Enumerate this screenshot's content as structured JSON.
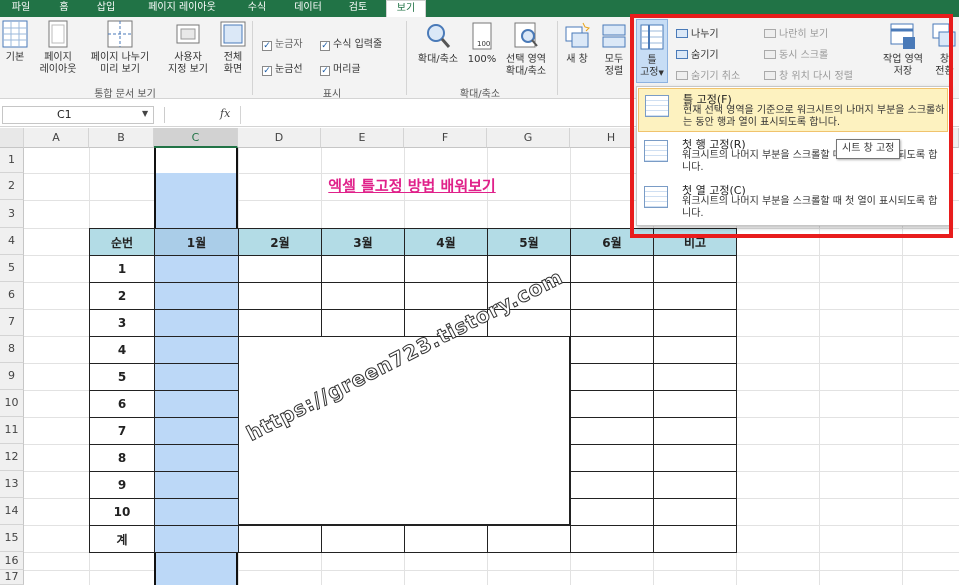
{
  "tabs": [
    "파일",
    "홈",
    "삽입",
    "페이지 레이아웃",
    "수식",
    "데이터",
    "검토",
    "보기"
  ],
  "active_tab": "보기",
  "ribbon": {
    "workbook_views": {
      "normal": "기본",
      "page_layout": [
        "페이지",
        "레이아웃"
      ],
      "page_break": [
        "페이지 나누기",
        "미리 보기"
      ],
      "custom": [
        "사용자",
        "지정 보기"
      ],
      "full": [
        "전체",
        "화면"
      ],
      "group_label": "통합 문서 보기"
    },
    "show": {
      "ruler": "눈금자",
      "formula_bar": "수식 입력줄",
      "gridlines": "눈금선",
      "headings": "머리글",
      "group_label": "표시"
    },
    "zoom": {
      "zoom": "확대/축소",
      "hundred": "100%",
      "zoom_selection": [
        "선택 영역",
        "확대/축소"
      ],
      "group_label": "확대/축소"
    },
    "window": {
      "new_window": "새 창",
      "arrange_all": [
        "모두",
        "정렬"
      ],
      "freeze": [
        "틀",
        "고정"
      ],
      "split": "나누기",
      "hide": "숨기기",
      "unhide": "숨기기 취소",
      "side_by_side": "나란히 보기",
      "sync_scroll": "동시 스크롤",
      "reset_position": "창 위치 다시 정렬",
      "save_workspace": [
        "작업 영역",
        "저장"
      ],
      "switch": [
        "창",
        "전환"
      ]
    }
  },
  "name_box": "C1",
  "fx": "fx",
  "columns": [
    "A",
    "B",
    "C",
    "D",
    "E",
    "F",
    "G",
    "H",
    "I"
  ],
  "rows": [
    "1",
    "2",
    "3",
    "4",
    "5",
    "6",
    "7",
    "8",
    "9",
    "10",
    "11",
    "12",
    "13",
    "14",
    "15",
    "16",
    "17"
  ],
  "sheet": {
    "title": "엑셀 틀고정 방법 배워보기",
    "headers": [
      "순번",
      "1월",
      "2월",
      "3월",
      "4월",
      "5월",
      "6월",
      "비고"
    ],
    "row_labels": [
      "1",
      "2",
      "3",
      "4",
      "5",
      "6",
      "7",
      "8",
      "9",
      "10",
      "계"
    ],
    "watermark": "https://green723.tistory.com"
  },
  "freeze_menu": {
    "items": [
      {
        "title": "틀 고정(F)",
        "desc": "현재 선택 영역을 기준으로 워크시트의 나머지 부분을 스크롤하는 동안 행과 열이 표시되도록 합니다."
      },
      {
        "title": "첫 행 고정(R)",
        "desc": "워크시트의 나머지 부분을 스크롤할 때 첫 행이 표시되도록 합니다."
      },
      {
        "title": "첫 열 고정(C)",
        "desc": "워크시트의 나머지 부분을 스크롤할 때 첫 열이 표시되도록 합니다."
      }
    ]
  },
  "tooltip": "시트 창 고정",
  "colors": {
    "excel_green": "#217346",
    "selection_blue": "#bcd8f7",
    "header_fill": "#b3dce6",
    "title_pink": "#e0218a",
    "highlight_red": "#e81c1c"
  }
}
